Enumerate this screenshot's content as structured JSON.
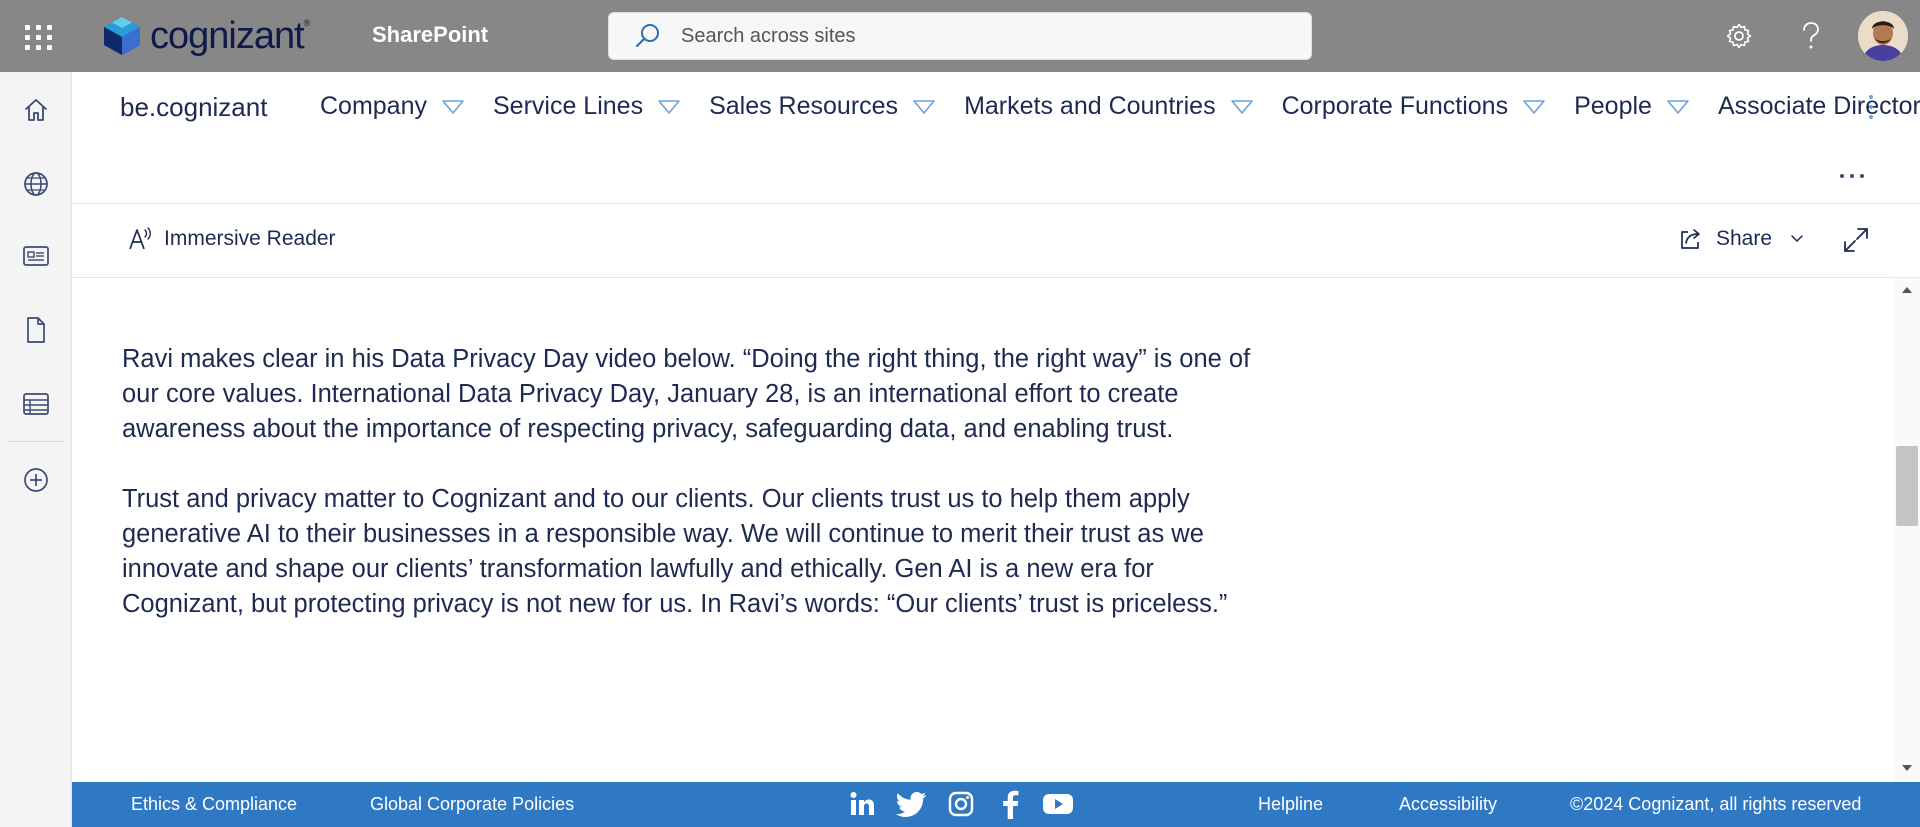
{
  "suitebar": {
    "brand": "cognizant",
    "trademark": "®",
    "app_title": "SharePoint",
    "search_placeholder": "Search across sites",
    "icons": [
      "app-launcher-icon",
      "settings-icon",
      "help-icon"
    ]
  },
  "rail": {
    "items": [
      "home-icon",
      "globe-icon",
      "news-icon",
      "document-icon",
      "list-icon",
      "add-icon"
    ]
  },
  "hubnav": {
    "site_name": "be.cognizant",
    "items": [
      {
        "label": "Company",
        "has_dropdown": true
      },
      {
        "label": "Service Lines",
        "has_dropdown": true
      },
      {
        "label": "Sales Resources",
        "has_dropdown": true
      },
      {
        "label": "Markets and Countries",
        "has_dropdown": true
      },
      {
        "label": "Corporate Functions",
        "has_dropdown": true
      },
      {
        "label": "People",
        "has_dropdown": true
      },
      {
        "label": "Associate Directory",
        "has_dropdown": false
      }
    ]
  },
  "commandbar": {
    "immersive_reader": "Immersive Reader",
    "share": "Share"
  },
  "article": {
    "paragraphs": [
      "Ravi makes clear in his Data Privacy Day video below.  “Doing the right thing, the right way” is one of our core values. International Data Privacy Day, January 28, is an international effort to create awareness about the importance of respecting privacy, safeguarding data, and enabling trust.",
      "Trust and privacy matter to Cognizant and to our clients. Our clients trust us to help them apply generative AI to their businesses in a responsible way. We will continue to merit their trust as we innovate and shape our clients’ transformation lawfully and ethically. Gen AI is a new era for Cognizant, but protecting privacy is not new for us.  In Ravi’s words: “Our clients’ trust is priceless.”"
    ]
  },
  "footer": {
    "left_links": [
      "Ethics & Compliance",
      "Global Corporate Policies"
    ],
    "social": [
      "linkedin-icon",
      "twitter-icon",
      "instagram-icon",
      "facebook-icon",
      "youtube-icon"
    ],
    "right_links": [
      "Helpline",
      "Accessibility"
    ],
    "copyright": "©2024 Cognizant, all rights reserved"
  },
  "colors": {
    "suitebar_bg": "#878787",
    "footer_bg": "#2f78c4",
    "text": "#1f2a52",
    "nav_caret": "#6ba3dc"
  }
}
